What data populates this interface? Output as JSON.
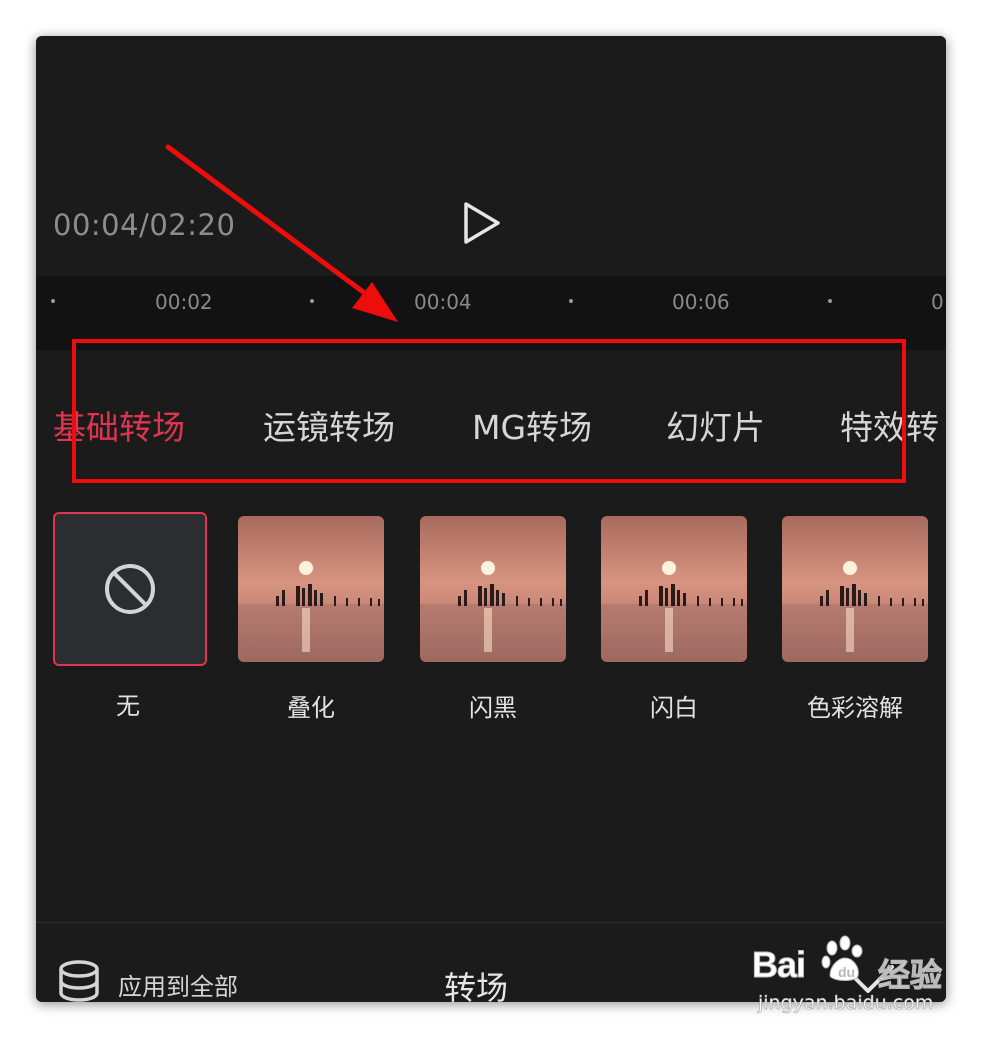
{
  "player": {
    "time": "00:04/02:20",
    "play_icon": "play-icon"
  },
  "timeline": {
    "labels": [
      "00:02",
      "00:04",
      "00:06",
      "0"
    ]
  },
  "tabs": [
    {
      "label": "基础转场",
      "active": true
    },
    {
      "label": "运镜转场",
      "active": false
    },
    {
      "label": "MG转场",
      "active": false
    },
    {
      "label": "幻灯片",
      "active": false
    },
    {
      "label": "特效转",
      "active": false
    }
  ],
  "transitions": [
    {
      "label": "无",
      "icon": "none-icon",
      "selected": true
    },
    {
      "label": "叠化",
      "icon": "sunset-thumbnail"
    },
    {
      "label": "闪黑",
      "icon": "sunset-thumbnail"
    },
    {
      "label": "闪白",
      "icon": "sunset-thumbnail"
    },
    {
      "label": "色彩溶解",
      "icon": "sunset-thumbnail"
    }
  ],
  "bottom": {
    "apply_all_label": "应用到全部",
    "apply_all_icon": "layers-icon",
    "title": "转场",
    "confirm_icon": "check-icon"
  },
  "watermark": {
    "brand": "Bai",
    "brand_suffix": "经验",
    "url": "jingyan.baidu.com"
  },
  "colors": {
    "accent": "#e0344f",
    "annotation_red": "#ee0d0d",
    "background": "#1b1b1b"
  }
}
